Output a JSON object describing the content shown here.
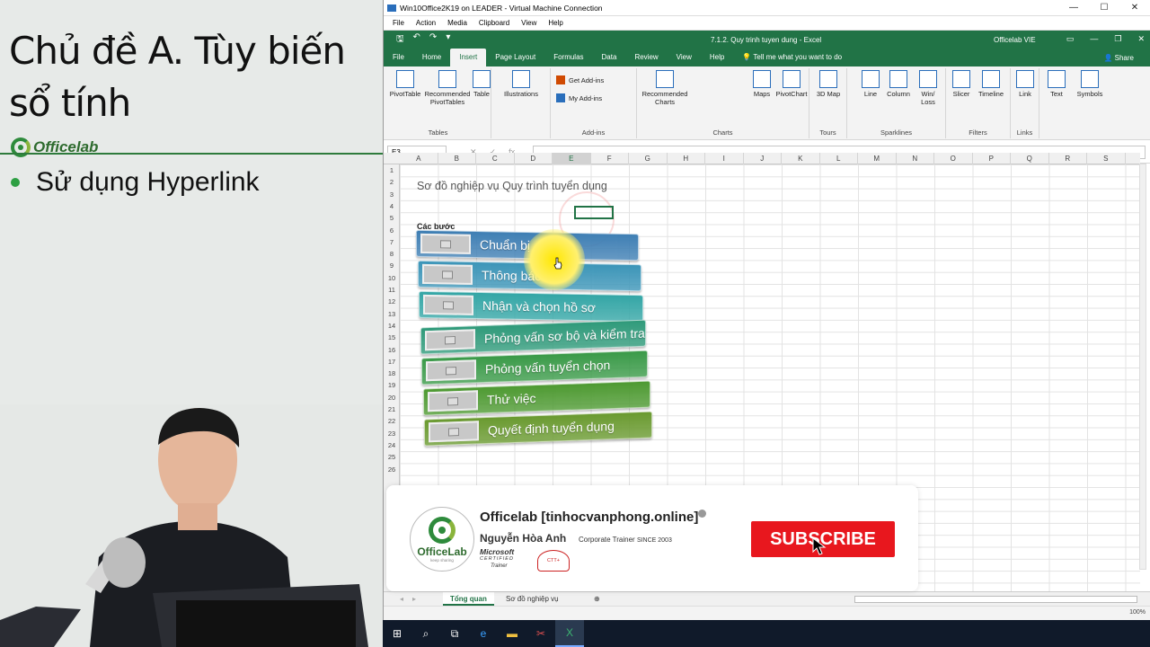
{
  "slide": {
    "title": "Chủ đề A. Tùy biến sổ tính",
    "logo_text": "Officelab",
    "bullet": "Sử dụng Hyperlink"
  },
  "vm": {
    "title": "Win10Office2K19 on LEADER - Virtual Machine Connection",
    "menu": [
      "File",
      "Action",
      "Media",
      "Clipboard",
      "View",
      "Help"
    ]
  },
  "excel": {
    "doc_title": "7.1.2. Quy trinh tuyen dung  -  Excel",
    "account": "Officelab VIE",
    "tabs": [
      "File",
      "Home",
      "Insert",
      "Page Layout",
      "Formulas",
      "Data",
      "Review",
      "View",
      "Help"
    ],
    "active_tab": "Insert",
    "tell_me": "Tell me what you want to do",
    "share": "Share",
    "ribbon": {
      "pivottable": "PivotTable",
      "recommended_pivot": "Recommended PivotTables",
      "table": "Table",
      "tables_group": "Tables",
      "illustrations": "Illustrations",
      "get_addins": "Get Add-ins",
      "my_addins": "My Add-ins",
      "addins_group": "Add-ins",
      "recommended_charts": "Recommended Charts",
      "maps": "Maps",
      "pivotchart": "PivotChart",
      "charts_group": "Charts",
      "map3d": "3D Map",
      "tours_group": "Tours",
      "line": "Line",
      "column": "Column",
      "winloss": "Win/ Loss",
      "sparklines_group": "Sparklines",
      "slicer": "Slicer",
      "timeline": "Timeline",
      "filters_group": "Filters",
      "link": "Link",
      "links_group": "Links",
      "text": "Text",
      "symbols": "Symbols"
    },
    "name_box": "E3",
    "columns": [
      "A",
      "B",
      "C",
      "D",
      "E",
      "F",
      "G",
      "H",
      "I",
      "J",
      "K",
      "L",
      "M",
      "N",
      "O",
      "P",
      "Q",
      "R",
      "S"
    ],
    "rows": [
      "1",
      "2",
      "3",
      "4",
      "5",
      "6",
      "7",
      "8",
      "9",
      "10",
      "11",
      "12",
      "13",
      "14",
      "15",
      "16",
      "17",
      "18",
      "19",
      "20",
      "21",
      "22",
      "23",
      "24",
      "25",
      "26"
    ],
    "a1_text": "Sơ đồ nghiệp vụ Quy trình tuyển dụng",
    "a4_text": "Các bước",
    "steps": [
      "Chuẩn bị",
      "Thông báo",
      "Nhận và chọn hồ sơ",
      "Phỏng vấn sơ bộ và kiểm tra",
      "Phỏng vấn tuyển chọn",
      "Thử việc",
      "Quyết định tuyển dụng"
    ],
    "step_colors": [
      "#3f7fb4",
      "#3c95b8",
      "#34a6a6",
      "#2f9a7a",
      "#3a9a48",
      "#4e9a32",
      "#6a9a30"
    ],
    "sheets": [
      "Tổng quan",
      "Sơ đồ nghiệp vụ"
    ],
    "active_sheet": "Tổng quan",
    "zoom": "100%"
  },
  "banner": {
    "name": "Officelab [tinhocvanphong.online]",
    "person": "Nguyễn Hòa Anh",
    "role": "Corporate Trainer",
    "since": "SINCE 2003",
    "logo_text": "OfficeLab",
    "logo_sub": "keep sharing",
    "ms_text": "Microsoft",
    "ms_cert": "CERTIFIED",
    "ms_trainer": "Trainer",
    "ctt": "CTT+",
    "subscribe": "SUBSCRIBE"
  }
}
